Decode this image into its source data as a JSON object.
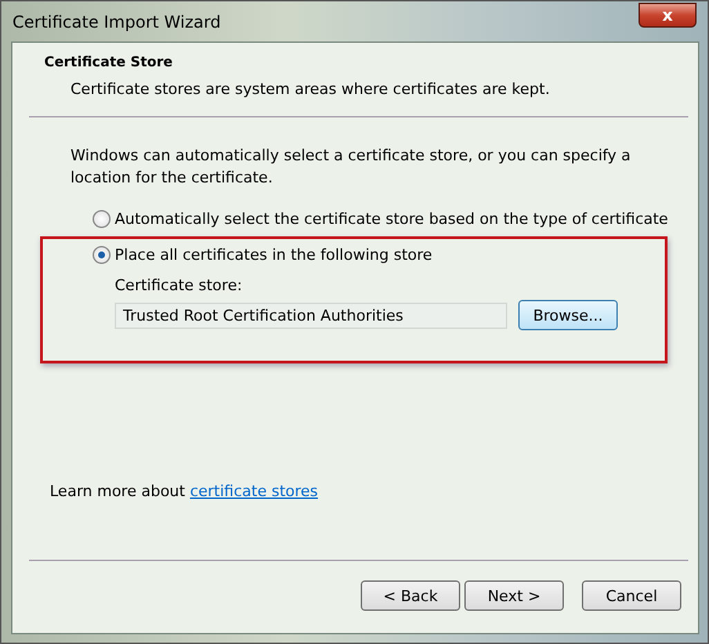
{
  "window": {
    "title": "Certificate Import Wizard",
    "close": "x"
  },
  "header": {
    "title": "Certificate Store",
    "subtitle": "Certificate stores are system areas where certificates are kept."
  },
  "intro": "Windows can automatically select a certificate store, or you can specify a location for the certificate.",
  "options": [
    {
      "label": "Automatically select the certificate store based on the type of certificate",
      "selected": false
    },
    {
      "label": "Place all certificates in the following store",
      "selected": true
    }
  ],
  "store": {
    "label": "Certificate store:",
    "value": "Trusted Root Certification Authorities",
    "browse": "Browse..."
  },
  "learn_more": {
    "text": "Learn more about",
    "link": "certificate stores"
  },
  "buttons": [
    {
      "label": "< Back"
    },
    {
      "label": "Next >"
    },
    {
      "label": "Cancel"
    }
  ]
}
